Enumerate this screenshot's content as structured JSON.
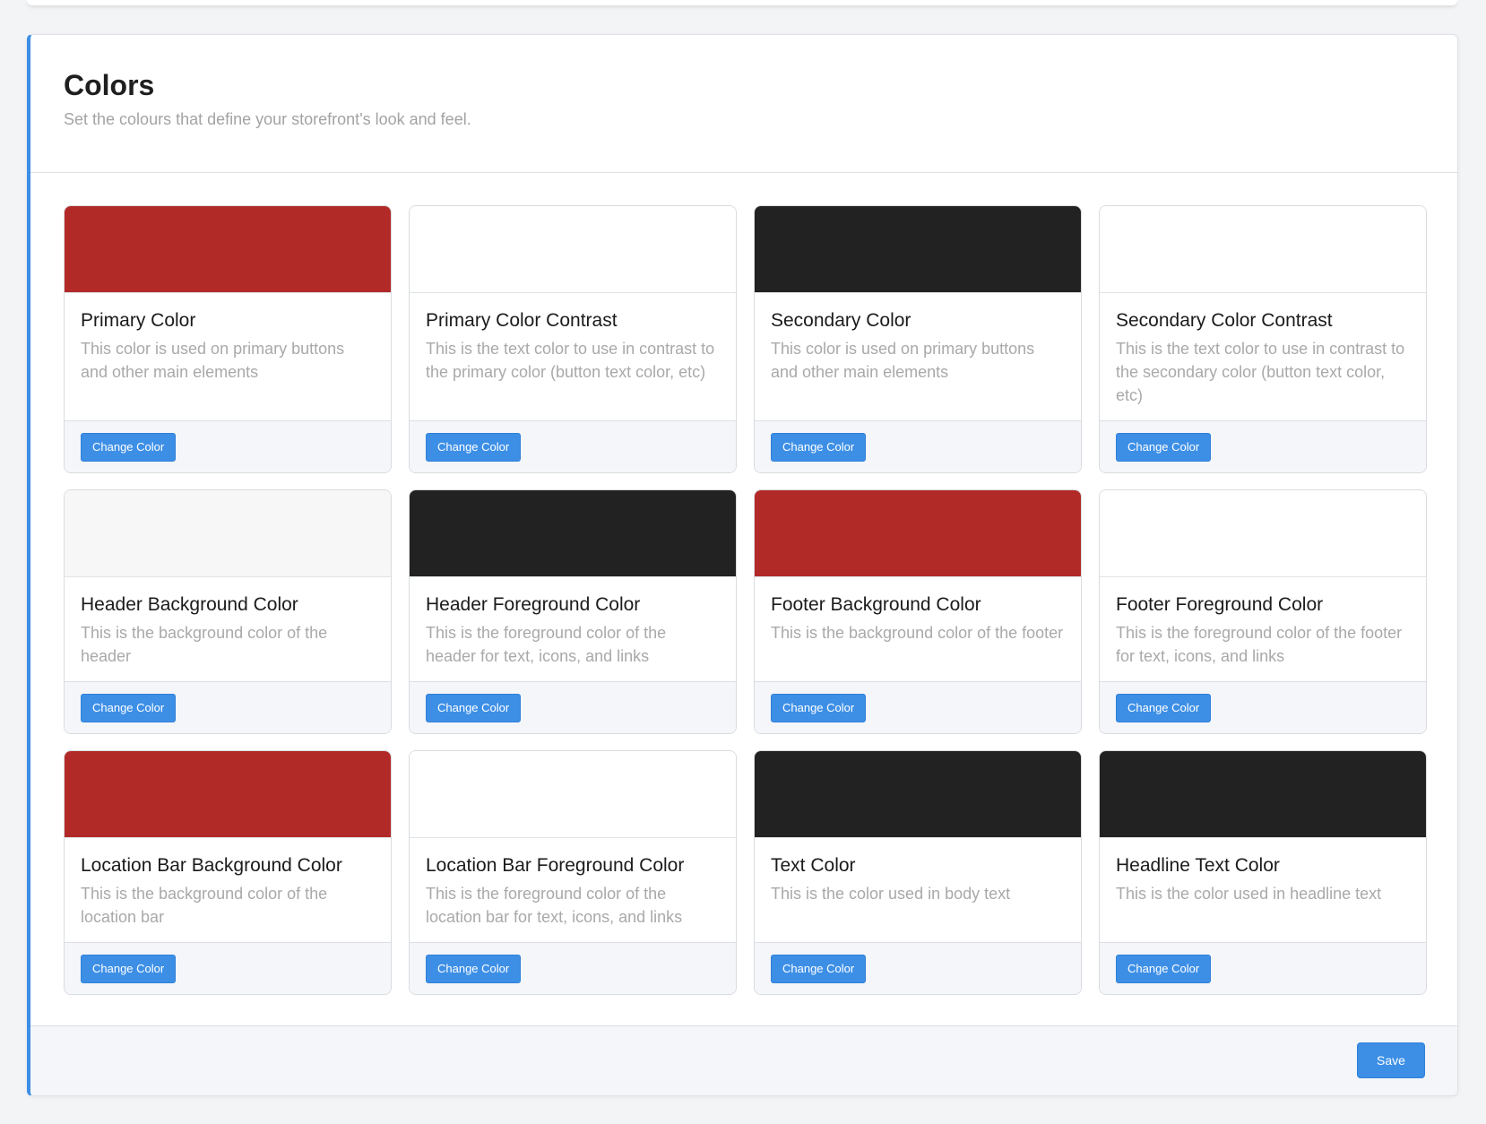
{
  "header": {
    "title": "Colors",
    "subtitle": "Set the colours that define your storefront's look and feel."
  },
  "cards": [
    {
      "title": "Primary Color",
      "description": "This color is used on primary buttons and other main elements",
      "color": "#b22a28",
      "button_label": "Change Color"
    },
    {
      "title": "Primary Color Contrast",
      "description": "This is the text color to use in contrast to the primary color (button text color, etc)",
      "color": "#ffffff",
      "button_label": "Change Color"
    },
    {
      "title": "Secondary Color",
      "description": "This color is used on primary buttons and other main elements",
      "color": "#222222",
      "button_label": "Change Color"
    },
    {
      "title": "Secondary Color Contrast",
      "description": "This is the text color to use in contrast to the secondary color (button text color, etc)",
      "color": "#ffffff",
      "button_label": "Change Color"
    },
    {
      "title": "Header Background Color",
      "description": "This is the background color of the header",
      "color": "#f7f7f7",
      "button_label": "Change Color"
    },
    {
      "title": "Header Foreground Color",
      "description": "This is the foreground color of the header for text, icons, and links",
      "color": "#222222",
      "button_label": "Change Color"
    },
    {
      "title": "Footer Background Color",
      "description": "This is the background color of the footer",
      "color": "#b22a28",
      "button_label": "Change Color"
    },
    {
      "title": "Footer Foreground Color",
      "description": "This is the foreground color of the footer for text, icons, and links",
      "color": "#ffffff",
      "button_label": "Change Color"
    },
    {
      "title": "Location Bar Background Color",
      "description": "This is the background color of the location bar",
      "color": "#b22a28",
      "button_label": "Change Color"
    },
    {
      "title": "Location Bar Foreground Color",
      "description": "This is the foreground color of the location bar for text, icons, and links",
      "color": "#ffffff",
      "button_label": "Change Color"
    },
    {
      "title": "Text Color",
      "description": "This is the color used in body text",
      "color": "#222222",
      "button_label": "Change Color"
    },
    {
      "title": "Headline Text Color",
      "description": "This is the color used in headline text",
      "color": "#222222",
      "button_label": "Change Color"
    }
  ],
  "footer": {
    "save_label": "Save"
  },
  "colors": {
    "accent": "#3d8fe6"
  }
}
